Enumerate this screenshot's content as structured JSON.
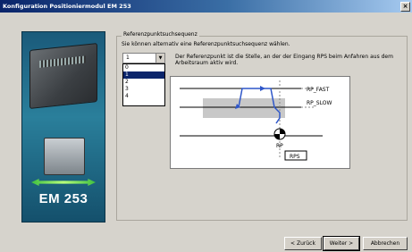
{
  "window": {
    "title": "Konfiguration Positioniermodul EM 253"
  },
  "side_image": {
    "label": "EM 253"
  },
  "group": {
    "title": "Referenzpunktsuchsequenz",
    "description": "Sie können alternativ eine Referenzpunktsuchsequenz wählen."
  },
  "sequence_select": {
    "value": "1",
    "options": [
      "0",
      "1",
      "2",
      "3",
      "4"
    ],
    "selected_index": 1
  },
  "info_text": "Der Referenzpunkt ist die Stelle, an der der Eingang RPS beim Anfahren aus dem Arbeitsraum aktiv wird.",
  "diagram": {
    "rp_fast_label": "RP_FAST",
    "rp_slow_label": "RP_SLOW",
    "rp_label": "RP",
    "rps_label": "RPS"
  },
  "buttons": {
    "back": "< Zurück",
    "next": "Weiter >",
    "cancel": "Abbrechen"
  },
  "colors": {
    "titlebar_start": "#0a246a",
    "trajectory": "#2f57c9",
    "selection": "#0a246a"
  }
}
